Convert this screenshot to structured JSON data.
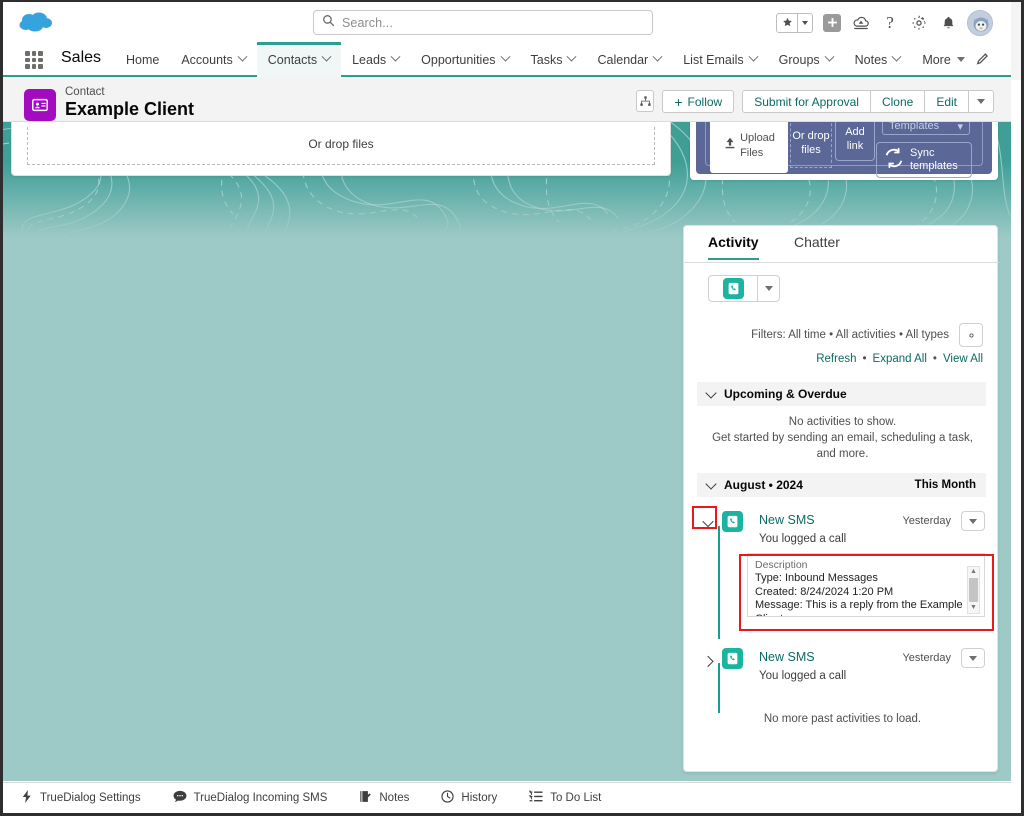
{
  "header": {
    "logo_icon": "salesforce-cloud-logo",
    "search": {
      "placeholder": "Search...",
      "value": "",
      "icon": "search-icon"
    },
    "icons": [
      {
        "name": "favorites-star-icon",
        "glyph": "★"
      },
      {
        "name": "favorites-caret-icon",
        "glyph": "▾"
      },
      {
        "name": "add-plus-icon",
        "glyph": "+"
      },
      {
        "name": "cloud-setup-icon",
        "glyph": "☁"
      },
      {
        "name": "help-question-icon",
        "glyph": "?"
      },
      {
        "name": "settings-gear-icon",
        "glyph": "⚙"
      },
      {
        "name": "notifications-bell-icon",
        "glyph": "🔔"
      },
      {
        "name": "user-avatar",
        "glyph": ""
      }
    ]
  },
  "nav": {
    "app_launcher_icon": "app-launcher-waffle-icon",
    "app_name": "Sales",
    "items": [
      {
        "label": "Home",
        "has_caret": false,
        "active": false
      },
      {
        "label": "Accounts",
        "has_caret": true,
        "active": false
      },
      {
        "label": "Contacts",
        "has_caret": true,
        "active": true
      },
      {
        "label": "Leads",
        "has_caret": true,
        "active": false
      },
      {
        "label": "Opportunities",
        "has_caret": true,
        "active": false
      },
      {
        "label": "Tasks",
        "has_caret": true,
        "active": false
      },
      {
        "label": "Calendar",
        "has_caret": true,
        "active": false
      },
      {
        "label": "List Emails",
        "has_caret": true,
        "active": false
      },
      {
        "label": "Groups",
        "has_caret": true,
        "active": false
      },
      {
        "label": "Notes",
        "has_caret": true,
        "active": false
      },
      {
        "label": "More",
        "has_caret": true,
        "active": false
      }
    ],
    "edit_pencil_icon": "edit-pencil-icon",
    "accent_color": "#2d9e8f"
  },
  "record": {
    "icon": "contact-card-icon",
    "icon_color": "#a20bc0",
    "type_label": "Contact",
    "title": "Example Client",
    "hierarchy_icon": "org-hierarchy-icon",
    "actions": [
      {
        "label": "Follow",
        "icon": "plus-icon"
      },
      {
        "label": "Submit for Approval"
      },
      {
        "label": "Clone"
      },
      {
        "label": "Edit"
      },
      {
        "label": "",
        "icon": "caret-down-icon"
      }
    ]
  },
  "files_card": {
    "drop_text": "Or drop files"
  },
  "templates_card": {
    "upload_label_line1": "Upload",
    "upload_label_line2": "Files",
    "upload_icon": "upload-icon",
    "drop_text": "Or drop files",
    "add_link_text": "Add link",
    "templates_select": "Templates",
    "sync_label_line1": "Sync",
    "sync_label_line2": "templates",
    "sync_icon": "sync-refresh-icon",
    "panel_color": "#4d5b8f"
  },
  "activity": {
    "tabs": [
      {
        "label": "Activity",
        "active": true
      },
      {
        "label": "Chatter",
        "active": false
      }
    ],
    "composer": {
      "icon": "sms-phone-icon",
      "caret_icon": "caret-down-icon"
    },
    "filters_text": "Filters: All time • All activities • All types",
    "filters_gear_icon": "filter-gear-icon",
    "links": [
      "Refresh",
      "Expand All",
      "View All"
    ],
    "link_separator": "•",
    "upcoming_section": {
      "title": "Upcoming & Overdue",
      "chevron_icon": "chevron-down-icon",
      "empty_line1": "No activities to show.",
      "empty_line2": "Get started by sending an email, scheduling a task, and more."
    },
    "month_section": {
      "title": "August • 2024",
      "right_label": "This Month",
      "chevron_icon": "chevron-down-icon"
    },
    "items": [
      {
        "expanded": true,
        "chevron_icon": "chevron-down-icon",
        "icon": "sms-phone-icon",
        "title": "New SMS",
        "when": "Yesterday",
        "menu_icon": "caret-down-icon",
        "subtitle": "You logged a call",
        "description": {
          "label": "Description",
          "lines": [
            "Type: Inbound Messages",
            "Created: 8/24/2024 1:20 PM",
            "Message: This is a reply from the Example Client."
          ],
          "scrollbar": {
            "up_icon": "scroll-up-arrow",
            "down_icon": "scroll-down-arrow"
          }
        }
      },
      {
        "expanded": false,
        "chevron_icon": "chevron-right-icon",
        "icon": "sms-phone-icon",
        "title": "New SMS",
        "when": "Yesterday",
        "menu_icon": "caret-down-icon",
        "subtitle": "You logged a call"
      }
    ],
    "no_more_text": "No more past activities to load.",
    "accent_color": "#1bb4a0",
    "link_color": "#0b6b63"
  },
  "annotations": {
    "highlight_color": "#e8191b",
    "boxes": [
      {
        "name": "expand-chevron-highlight"
      },
      {
        "name": "description-highlight"
      }
    ]
  },
  "utility_bar": {
    "items": [
      {
        "label": "TrueDialog Settings",
        "icon": "lightning-bolt-icon"
      },
      {
        "label": "TrueDialog Incoming SMS",
        "icon": "chat-bubble-icon"
      },
      {
        "label": "Notes",
        "icon": "notes-icon"
      },
      {
        "label": "History",
        "icon": "clock-icon"
      },
      {
        "label": "To Do List",
        "icon": "todo-list-icon"
      }
    ]
  },
  "theme": {
    "background_teal": "#9dc9c6",
    "topo_teal": "#3f9f97"
  }
}
